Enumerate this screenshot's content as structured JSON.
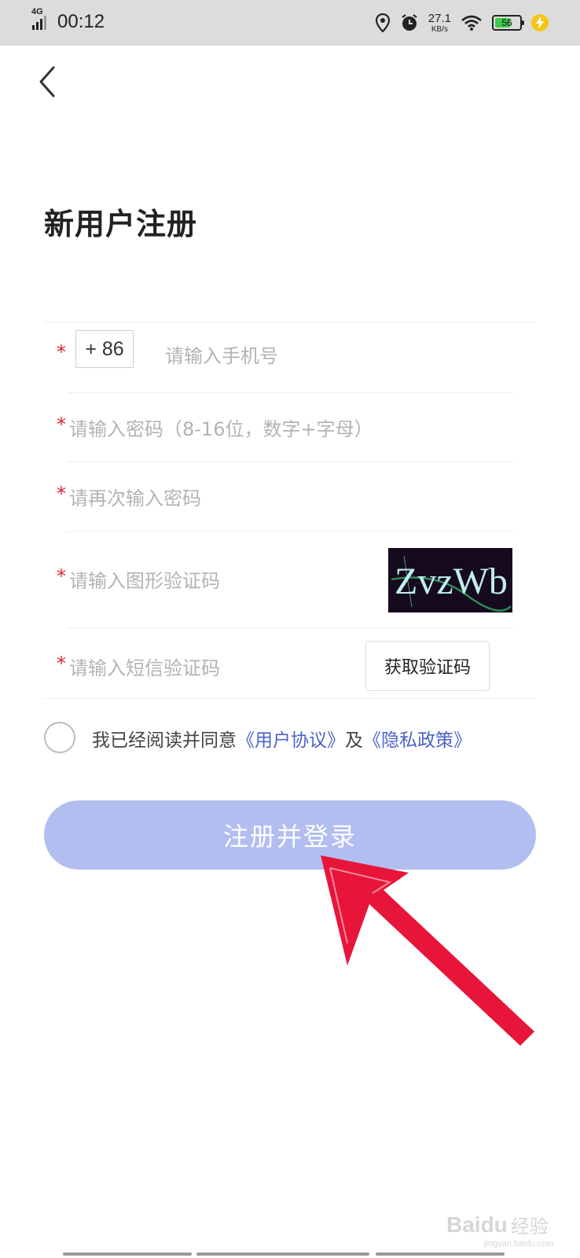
{
  "status_bar": {
    "network": "4G",
    "time": "00:12",
    "speed_value": "27.1",
    "speed_unit": "KB/s",
    "battery_level": "56",
    "icons": [
      "signal-icon",
      "location-icon",
      "alarm-icon",
      "wifi-icon",
      "battery-icon",
      "charging-icon"
    ]
  },
  "header": {
    "back_icon": "chevron-left-icon",
    "title": "新用户注册"
  },
  "form": {
    "required_mark": "*",
    "country_code": "+ 86",
    "phone_placeholder": "请输入手机号",
    "password_placeholder": "请输入密码（8-16位，数字+字母）",
    "confirm_password_placeholder": "请再次输入密码",
    "captcha_placeholder": "请输入图形验证码",
    "captcha_image_text": "ZvzWb",
    "sms_placeholder": "请输入短信验证码",
    "sms_button": "获取验证码"
  },
  "agreement": {
    "checked": false,
    "prefix": "我已经阅读并同意",
    "user_agreement": "《用户协议》",
    "conjunction": "及",
    "privacy_policy": "《隐私政策》"
  },
  "submit_button": "注册并登录",
  "colors": {
    "status_bar_bg": "#dcdcdc",
    "required_star": "#e02433",
    "link": "#4a63c9",
    "submit_bg": "#b3bef0",
    "annotation_arrow": "#e8153a",
    "battery_fill": "#3dc94a",
    "charge": "#f5c518"
  },
  "watermark": {
    "brand": "Baidu",
    "label": "经验",
    "url": "jingyan.baidu.com"
  }
}
